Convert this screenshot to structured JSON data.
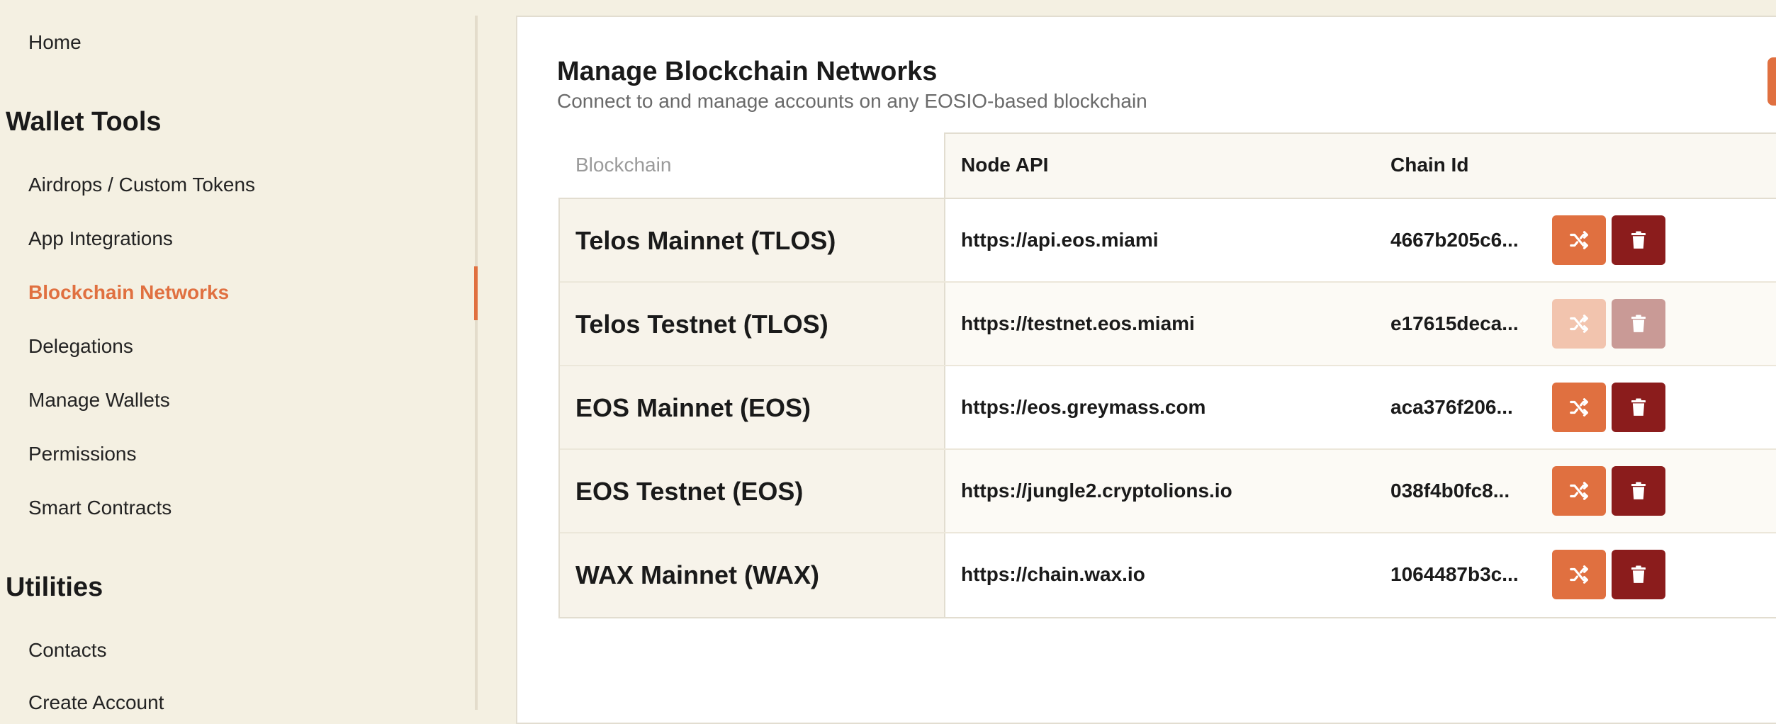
{
  "sidebar": {
    "home": "Home",
    "wallet_tools_title": "Wallet Tools",
    "wallet_tools": [
      {
        "label": "Airdrops / Custom Tokens"
      },
      {
        "label": "App Integrations"
      },
      {
        "label": "Blockchain Networks",
        "active": true
      },
      {
        "label": "Delegations"
      },
      {
        "label": "Manage Wallets"
      },
      {
        "label": "Permissions"
      },
      {
        "label": "Smart Contracts"
      }
    ],
    "utilities_title": "Utilities",
    "utilities": [
      {
        "label": "Contacts"
      },
      {
        "label": "Create Account"
      }
    ]
  },
  "panel": {
    "title": "Manage Blockchain Networks",
    "subtitle": "Connect to and manage accounts on any EOSIO-based blockchain"
  },
  "table": {
    "headers": {
      "blockchain": "Blockchain",
      "node_api": "Node API",
      "chain_id": "Chain Id"
    },
    "rows": [
      {
        "name": "Telos Mainnet (TLOS)",
        "node": "https://api.eos.miami",
        "chain_id": "4667b205c6...",
        "actions_enabled": true
      },
      {
        "name": "Telos Testnet (TLOS)",
        "node": "https://testnet.eos.miami",
        "chain_id": "e17615deca...",
        "actions_enabled": false
      },
      {
        "name": "EOS Mainnet (EOS)",
        "node": "https://eos.greymass.com",
        "chain_id": "aca376f206...",
        "actions_enabled": true
      },
      {
        "name": "EOS Testnet (EOS)",
        "node": "https://jungle2.cryptolions.io",
        "chain_id": "038f4b0fc8...",
        "actions_enabled": true
      },
      {
        "name": "WAX Mainnet (WAX)",
        "node": "https://chain.wax.io",
        "chain_id": "1064487b3c...",
        "actions_enabled": true
      }
    ],
    "action_icons": {
      "switch": "shuffle-icon",
      "delete": "trash-icon"
    }
  },
  "colors": {
    "accent": "#e07040",
    "danger": "#8b1c1c",
    "sidebar_bg": "#f4f0e2"
  }
}
